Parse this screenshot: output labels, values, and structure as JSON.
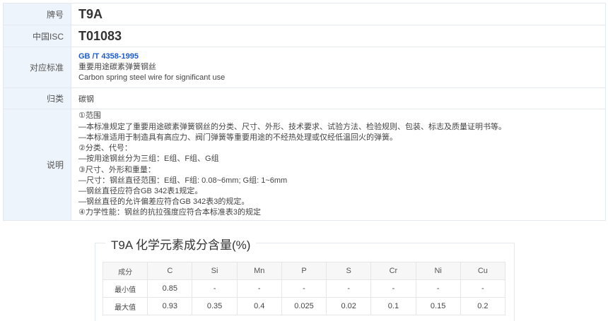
{
  "rows": {
    "grade": {
      "label": "牌号",
      "value": "T9A"
    },
    "isc": {
      "label": "中国ISC",
      "value": "T01083"
    },
    "standard": {
      "label": "对应标准",
      "code": "GB /T 4358-1995",
      "name_cn": "重要用途碳素弹簧钢丝",
      "name_en": "Carbon spring steel wire for significant use"
    },
    "category": {
      "label": "归类",
      "value": "碳钢"
    },
    "description": {
      "label": "说明",
      "lines": [
        "①范围",
        "—本标准规定了重要用途碳素弹簧钢丝的分类、尺寸、外形、技术要求、试验方法、检验规则、包装、标志及质量证明书等。",
        "—本标准适用于制造具有高应力、阀门弹簧等重要用途的不经热处理或仅经低温回火的弹簧。",
        "②分类、代号：",
        "—按用途钢丝分为三组：E组、F组、G组",
        "③尺寸、外形和重量：",
        "—尺寸：钢丝直径范围：E组、F组: 0.08~6mm; G组: 1~6mm",
        "—钢丝直径应符合GB 342表1规定。",
        "—钢丝直径的允许偏差应符合GB 342表3的规定。",
        "④力学性能：钢丝的抗拉强度应符合本标准表3的规定"
      ]
    }
  },
  "composition": {
    "title": "T9A 化学元素成分含量(%)",
    "header": [
      "成分",
      "C",
      "Si",
      "Mn",
      "P",
      "S",
      "Cr",
      "Ni",
      "Cu"
    ],
    "rows": [
      [
        "最小值",
        "0.85",
        "-",
        "-",
        "-",
        "-",
        "-",
        "-",
        "-"
      ],
      [
        "最大值",
        "0.93",
        "0.35",
        "0.4",
        "0.025",
        "0.02",
        "0.1",
        "0.15",
        "0.2"
      ]
    ]
  }
}
